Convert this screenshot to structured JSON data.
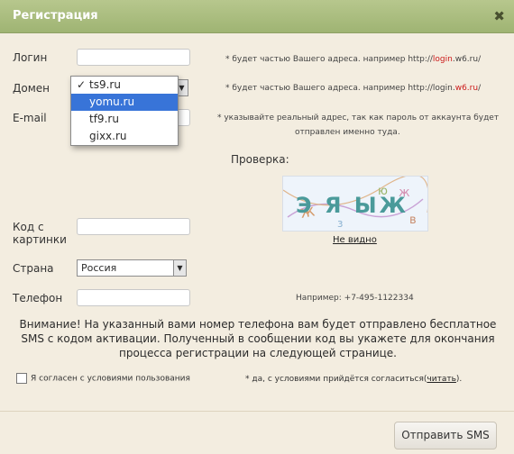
{
  "dialog": {
    "title": "Регистрация"
  },
  "fields": {
    "login_label": "Логин",
    "domain_label": "Домен",
    "email_label": "E-mail",
    "captcha_label_line1": "Код с",
    "captcha_label_line2": "картинки",
    "country_label": "Страна",
    "country_value": "Россия",
    "phone_label": "Телефон"
  },
  "hints": {
    "login_pre": "* будет частью Вашего адреса. например http://",
    "login_red": "login",
    "login_post": ".w6.ru/",
    "domain_pre": "* будет частью Вашего адреса. например http://login.",
    "domain_red": "w6.ru",
    "domain_post": "/",
    "email_line1": "* указывайте реальный адрес, так как пароль от аккаунта будет",
    "email_line2": "отправлен именно туда.",
    "phone_example": "Например: +7-495-1122334"
  },
  "domain_dropdown": {
    "options": [
      "ts9.ru",
      "yomu.ru",
      "tf9.ru",
      "gixx.ru"
    ],
    "checked_index": 0,
    "highlighted_index": 1
  },
  "captcha": {
    "title": "Проверка:",
    "image_text": "Э Я ЫЖ",
    "not_visible_link": "Не видно"
  },
  "notice": "Внимание! На указанный вами номер телефона вам будет отправлено бесплатное SMS с кодом активации. Полученный в сообщении код вы укажете для окончания процесса регистрации на следующей странице.",
  "agreement": {
    "checkbox_label": "Я согласен с условиями пользования",
    "checked": false,
    "note_pre": "* да, с условиями прийдётся согласиться(",
    "note_link": "читать",
    "note_post": ")."
  },
  "buttons": {
    "send_sms": "Отправить SMS"
  },
  "colors": {
    "titlebar": "#a9bc7f",
    "background": "#f3ede0",
    "accent_red": "#cc1b1b",
    "selection": "#3874d8"
  },
  "icons": {
    "close": "close-icon",
    "select_arrow": "chevron-down-icon"
  }
}
